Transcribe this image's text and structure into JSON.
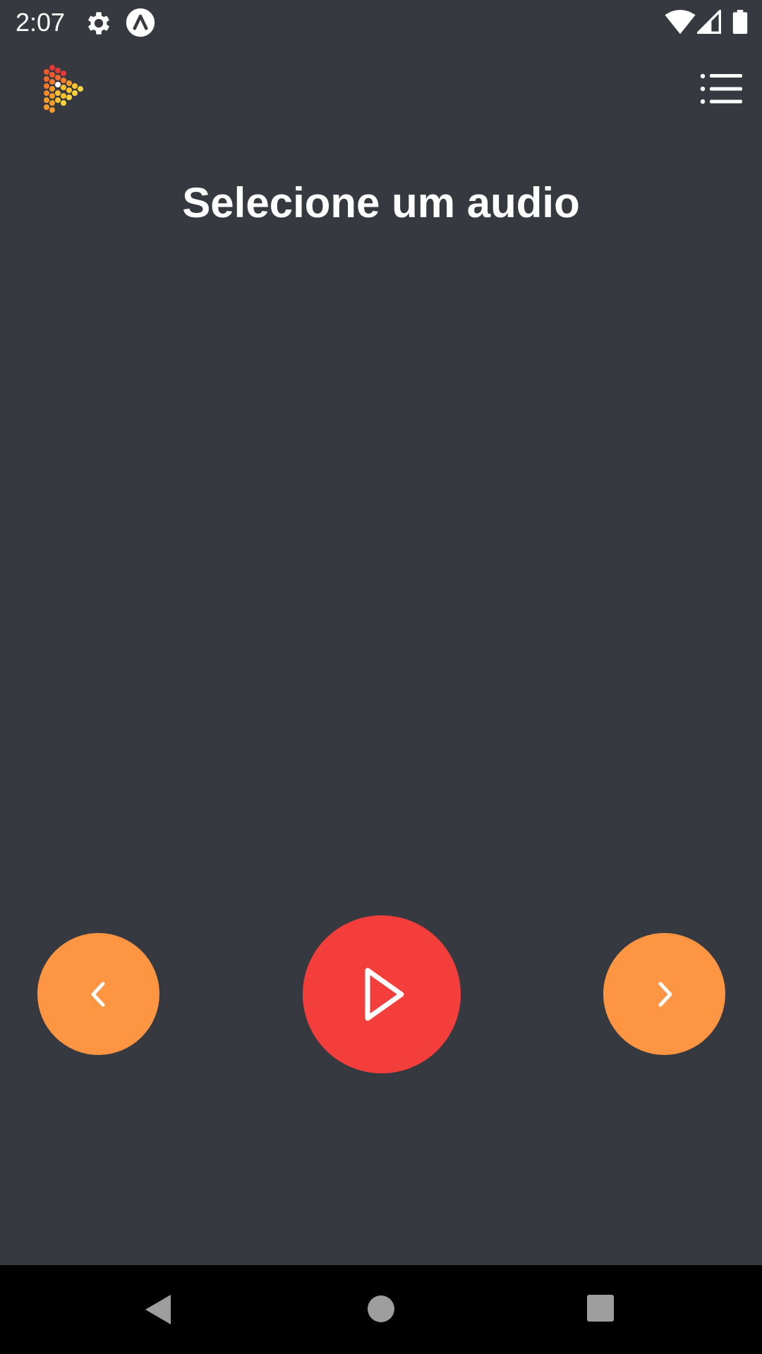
{
  "status_bar": {
    "time": "2:07",
    "icons": [
      "gear-icon",
      "expo-icon",
      "wifi-icon",
      "signal-icon",
      "battery-icon"
    ]
  },
  "header": {
    "logo": "app-logo-icon",
    "menu_icon": "list-menu-icon"
  },
  "main": {
    "title": "Selecione um audio"
  },
  "controls": {
    "previous": "chevron-left-icon",
    "play": "play-icon",
    "next": "chevron-right-icon"
  },
  "nav_bar": {
    "buttons": [
      "back-icon",
      "home-icon",
      "recents-icon"
    ]
  },
  "colors": {
    "background": "#363940",
    "accent_orange": "#fd9542",
    "accent_red": "#f43e3b",
    "text": "#ffffff",
    "nav_background": "#000000"
  }
}
